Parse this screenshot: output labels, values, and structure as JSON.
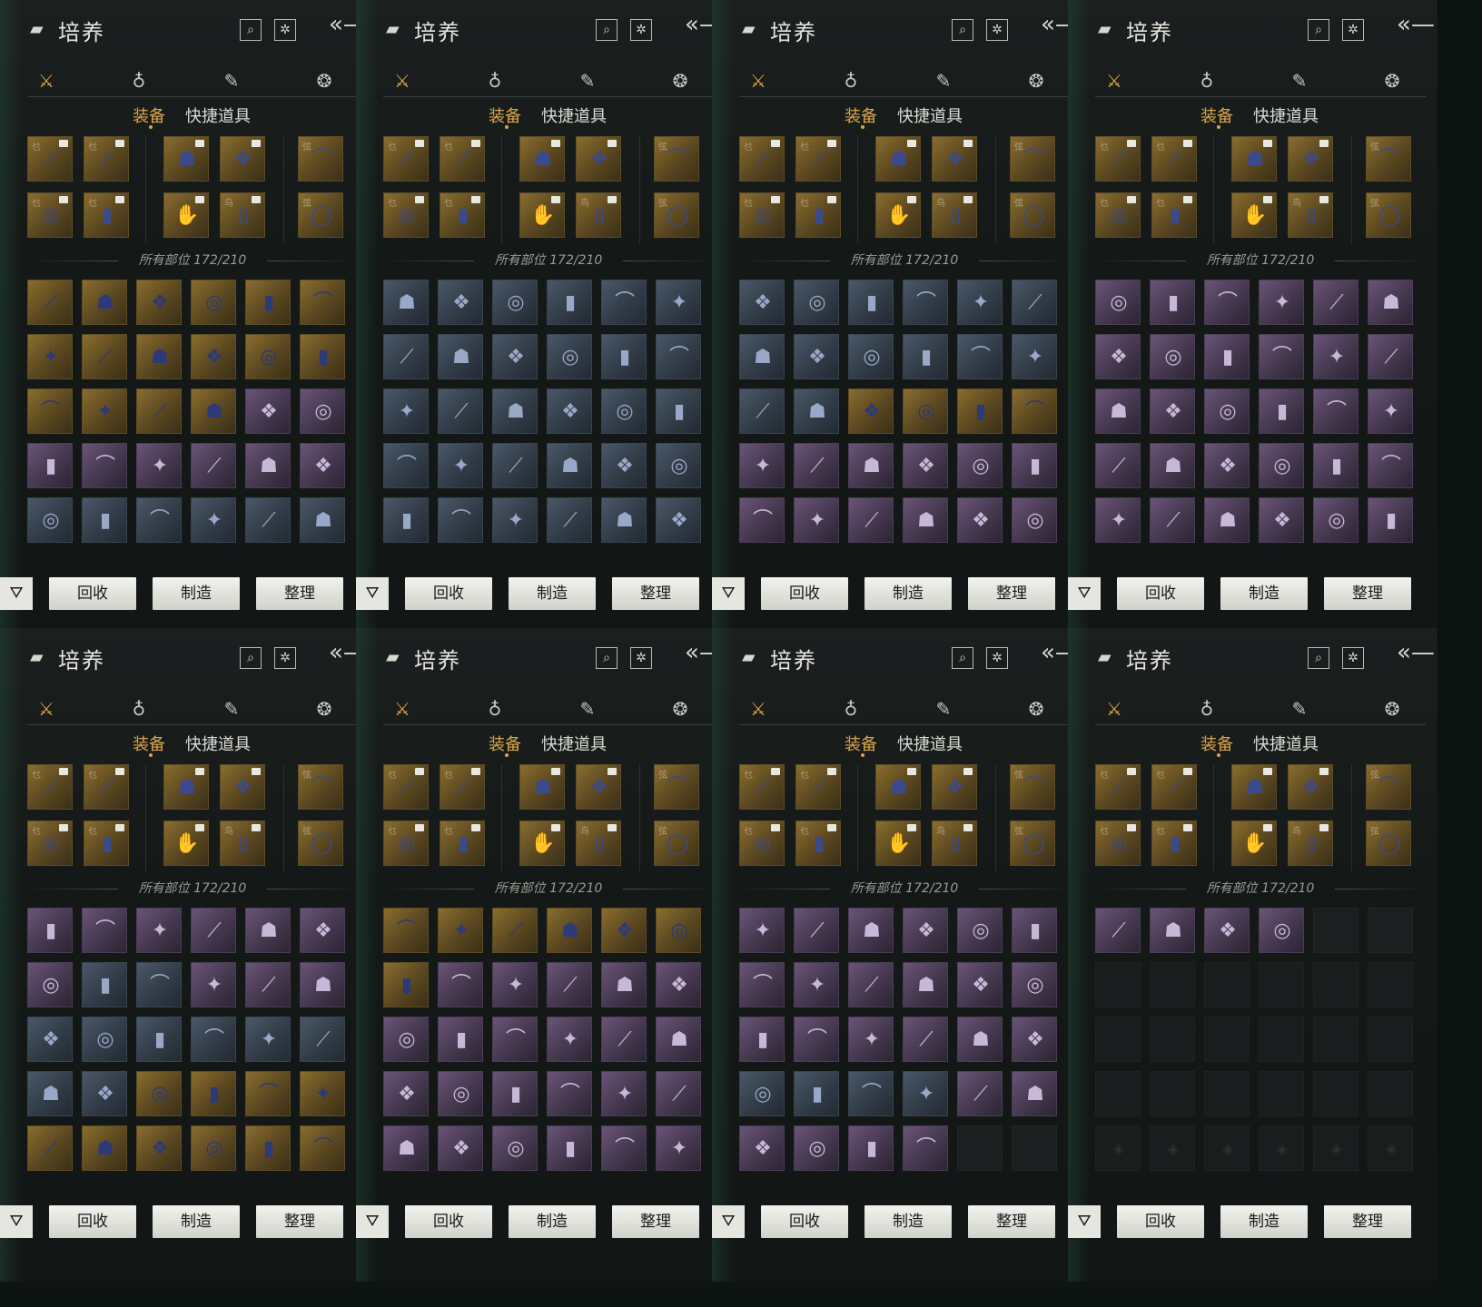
{
  "header": {
    "title": "培养",
    "title_icon": "box-icon",
    "search_icon": "search-icon",
    "settings_icon": "gear-icon",
    "back_icon": "back-arrow-icon"
  },
  "categories": [
    {
      "icon": "crossed-swords-icon",
      "glyph": "⚔",
      "active": true
    },
    {
      "icon": "pouch-icon",
      "glyph": "♁",
      "active": false
    },
    {
      "icon": "scroll-icon",
      "glyph": "✎",
      "active": false
    },
    {
      "icon": "token-icon",
      "glyph": "❂",
      "active": false
    }
  ],
  "subtabs": {
    "equipment": "装备",
    "quick_items": "快捷道具"
  },
  "count_text": "所有部位 172/210",
  "buttons": {
    "filter_icon": "filter-icon",
    "recycle": "回收",
    "craft": "制造",
    "sort": "整理"
  },
  "colors": {
    "accent_gold": "#d9a54a",
    "text_light": "#e8e6df",
    "rarity_gold": "#8a6d2e",
    "rarity_purple": "#6a5478",
    "rarity_blue": "#4a5868"
  },
  "panels": [
    {
      "id": 1,
      "inventory": [
        [
          "gold",
          "gold",
          "gold",
          "gold",
          "gold",
          "gold"
        ],
        [
          "gold",
          "gold",
          "gold",
          "gold",
          "gold",
          "gold"
        ],
        [
          "gold",
          "gold",
          "gold",
          "gold",
          "purple",
          "purple"
        ],
        [
          "purple",
          "purple",
          "purple",
          "purple",
          "purple",
          "purple"
        ],
        [
          "blue",
          "blue",
          "blue",
          "blue",
          "blue",
          "blue"
        ]
      ]
    },
    {
      "id": 2,
      "inventory": [
        [
          "blue",
          "blue",
          "blue",
          "blue",
          "blue",
          "blue"
        ],
        [
          "blue",
          "blue",
          "blue",
          "blue",
          "blue",
          "blue"
        ],
        [
          "blue",
          "blue",
          "blue",
          "blue",
          "blue",
          "blue"
        ],
        [
          "blue",
          "blue",
          "blue",
          "blue",
          "blue",
          "blue"
        ],
        [
          "blue",
          "blue",
          "blue",
          "blue",
          "blue",
          "blue"
        ]
      ]
    },
    {
      "id": 3,
      "inventory": [
        [
          "blue",
          "blue",
          "blue",
          "blue",
          "blue",
          "blue"
        ],
        [
          "blue",
          "blue",
          "blue",
          "blue",
          "blue",
          "blue"
        ],
        [
          "blue",
          "blue",
          "gold",
          "gold",
          "gold",
          "gold"
        ],
        [
          "purple",
          "purple",
          "purple",
          "purple",
          "purple",
          "purple"
        ],
        [
          "purple",
          "purple",
          "purple",
          "purple",
          "purple",
          "purple"
        ]
      ]
    },
    {
      "id": 4,
      "inventory": [
        [
          "purple",
          "purple",
          "purple",
          "purple",
          "purple",
          "purple"
        ],
        [
          "purple",
          "purple",
          "purple",
          "purple",
          "purple",
          "purple"
        ],
        [
          "purple",
          "purple",
          "purple",
          "purple",
          "purple",
          "purple"
        ],
        [
          "purple",
          "purple",
          "purple",
          "purple",
          "purple",
          "purple"
        ],
        [
          "purple",
          "purple",
          "purple",
          "purple",
          "purple",
          "purple"
        ]
      ]
    },
    {
      "id": 5,
      "inventory": [
        [
          "purple",
          "purple",
          "purple",
          "purple",
          "purple",
          "purple"
        ],
        [
          "purple",
          "blue",
          "blue",
          "purple",
          "purple",
          "purple"
        ],
        [
          "blue",
          "blue",
          "blue",
          "blue",
          "blue",
          "blue"
        ],
        [
          "blue",
          "blue",
          "gold",
          "gold",
          "gold",
          "gold"
        ],
        [
          "gold",
          "gold",
          "gold",
          "gold",
          "gold",
          "gold"
        ]
      ]
    },
    {
      "id": 6,
      "inventory": [
        [
          "gold",
          "gold",
          "gold",
          "gold",
          "gold",
          "gold"
        ],
        [
          "gold",
          "purple",
          "purple",
          "purple",
          "purple",
          "purple"
        ],
        [
          "purple",
          "purple",
          "purple",
          "purple",
          "purple",
          "purple"
        ],
        [
          "purple",
          "purple",
          "purple",
          "purple",
          "purple",
          "purple"
        ],
        [
          "purple",
          "purple",
          "purple",
          "purple",
          "purple",
          "purple"
        ]
      ]
    },
    {
      "id": 7,
      "inventory": [
        [
          "purple",
          "purple",
          "purple",
          "purple",
          "purple",
          "purple"
        ],
        [
          "purple",
          "purple",
          "purple",
          "purple",
          "purple",
          "purple"
        ],
        [
          "purple",
          "purple",
          "purple",
          "purple",
          "purple",
          "purple"
        ],
        [
          "blue",
          "blue",
          "blue",
          "blue",
          "purple",
          "purple"
        ],
        [
          "purple",
          "purple",
          "purple",
          "purple",
          "empty",
          "empty"
        ]
      ]
    },
    {
      "id": 8,
      "inventory": [
        [
          "purple",
          "purple",
          "purple",
          "purple",
          "empty",
          "empty"
        ],
        [
          "faint",
          "faint",
          "faint",
          "faint",
          "faint",
          "faint"
        ],
        [
          "faint",
          "faint",
          "faint",
          "faint",
          "faint",
          "faint"
        ],
        [
          "faint",
          "faint",
          "faint",
          "faint",
          "faint",
          "faint"
        ],
        [
          "faint",
          "faint",
          "faint",
          "faint",
          "faint",
          "faint"
        ]
      ]
    }
  ],
  "equipped": [
    {
      "rarity": "gold",
      "tag": "乜",
      "item": "spear-icon"
    },
    {
      "rarity": "gold",
      "tag": "乜",
      "item": "sword-icon"
    },
    {
      "rarity": "gold",
      "tag": "",
      "item": "helmet-icon"
    },
    {
      "rarity": "gold",
      "tag": "",
      "item": "armor-icon"
    },
    {
      "rarity": "gold",
      "tag": "弦",
      "item": "bow-icon"
    },
    {
      "rarity": "gold",
      "tag": "乜",
      "item": "ring-icon"
    },
    {
      "rarity": "gold",
      "tag": "乜",
      "item": "charm-icon"
    },
    {
      "rarity": "gold",
      "tag": "",
      "item": "gauntlet-icon"
    },
    {
      "rarity": "gold",
      "tag": "鸟",
      "item": "greaves-icon"
    },
    {
      "rarity": "gold",
      "tag": "弦",
      "item": "amulet-icon"
    }
  ]
}
